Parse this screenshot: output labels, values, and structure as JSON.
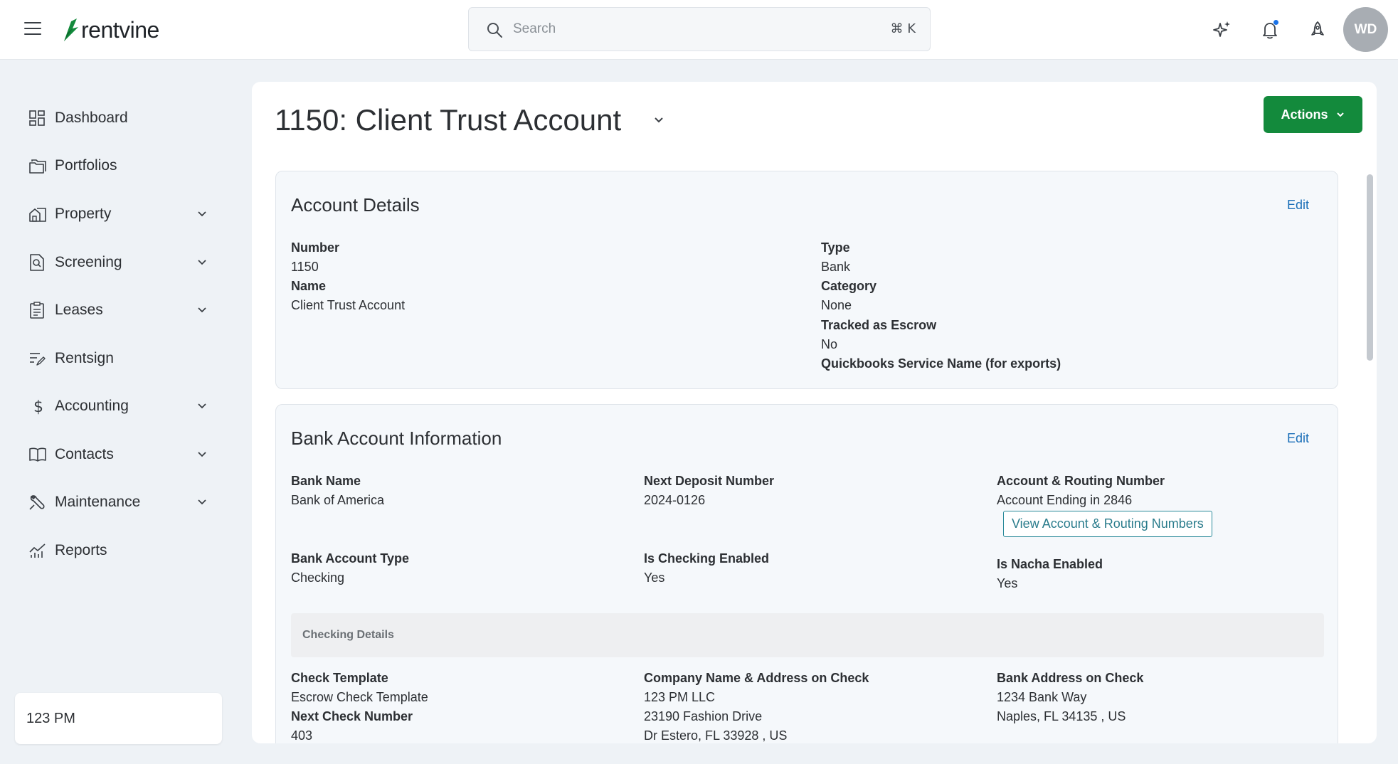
{
  "brand": {
    "name": "rentvine"
  },
  "search": {
    "placeholder": "Search",
    "shortcut": "⌘ K"
  },
  "user": {
    "initials": "WD"
  },
  "sidebar": {
    "items": [
      {
        "label": "Dashboard",
        "icon": "dashboard-icon",
        "expandable": false
      },
      {
        "label": "Portfolios",
        "icon": "folders-icon",
        "expandable": false
      },
      {
        "label": "Property",
        "icon": "property-icon",
        "expandable": true
      },
      {
        "label": "Screening",
        "icon": "screening-icon",
        "expandable": true
      },
      {
        "label": "Leases",
        "icon": "clipboard-icon",
        "expandable": true
      },
      {
        "label": "Rentsign",
        "icon": "signature-icon",
        "expandable": false
      },
      {
        "label": "Accounting",
        "icon": "dollar-icon",
        "expandable": true
      },
      {
        "label": "Contacts",
        "icon": "book-icon",
        "expandable": true
      },
      {
        "label": "Maintenance",
        "icon": "wrench-icon",
        "expandable": true
      },
      {
        "label": "Reports",
        "icon": "chart-icon",
        "expandable": false
      }
    ],
    "org": "123 PM"
  },
  "page": {
    "title": "1150: Client Trust Account",
    "actions_label": "Actions"
  },
  "account_details": {
    "title": "Account Details",
    "edit_label": "Edit",
    "number_label": "Number",
    "number_value": "1150",
    "name_label": "Name",
    "name_value": "Client Trust Account",
    "type_label": "Type",
    "type_value": "Bank",
    "category_label": "Category",
    "category_value": "None",
    "escrow_label": "Tracked as Escrow",
    "escrow_value": "No",
    "qb_label": "Quickbooks Service Name (for exports)"
  },
  "bank_info": {
    "title": "Bank Account Information",
    "edit_label": "Edit",
    "bank_name_label": "Bank Name",
    "bank_name_value": "Bank of America",
    "deposit_label": "Next Deposit Number",
    "deposit_value": "2024-0126",
    "routing_label": "Account & Routing Number",
    "routing_value": "Account Ending in 2846",
    "view_button": "View Account & Routing Numbers",
    "type_label": "Bank Account Type",
    "type_value": "Checking",
    "checking_label": "Is Checking Enabled",
    "checking_value": "Yes",
    "nacha_label": "Is Nacha Enabled",
    "nacha_value": "Yes",
    "checking_details_title": "Checking Details",
    "template_label": "Check Template",
    "template_value": "Escrow Check Template",
    "next_check_label": "Next Check Number",
    "next_check_value": "403",
    "company_label": "Company Name & Address on Check",
    "company_line1": "123 PM LLC",
    "company_line2": "23190 Fashion Drive",
    "company_line3": "Dr Estero, FL 33928 , US",
    "bank_addr_label": "Bank Address on Check",
    "bank_addr_line1": "1234 Bank Way",
    "bank_addr_line2": "Naples, FL 34135 , US"
  },
  "colors": {
    "brand_green": "#138a3c",
    "link_blue": "#1b6fb8",
    "notification_dot": "#1a73e8"
  }
}
